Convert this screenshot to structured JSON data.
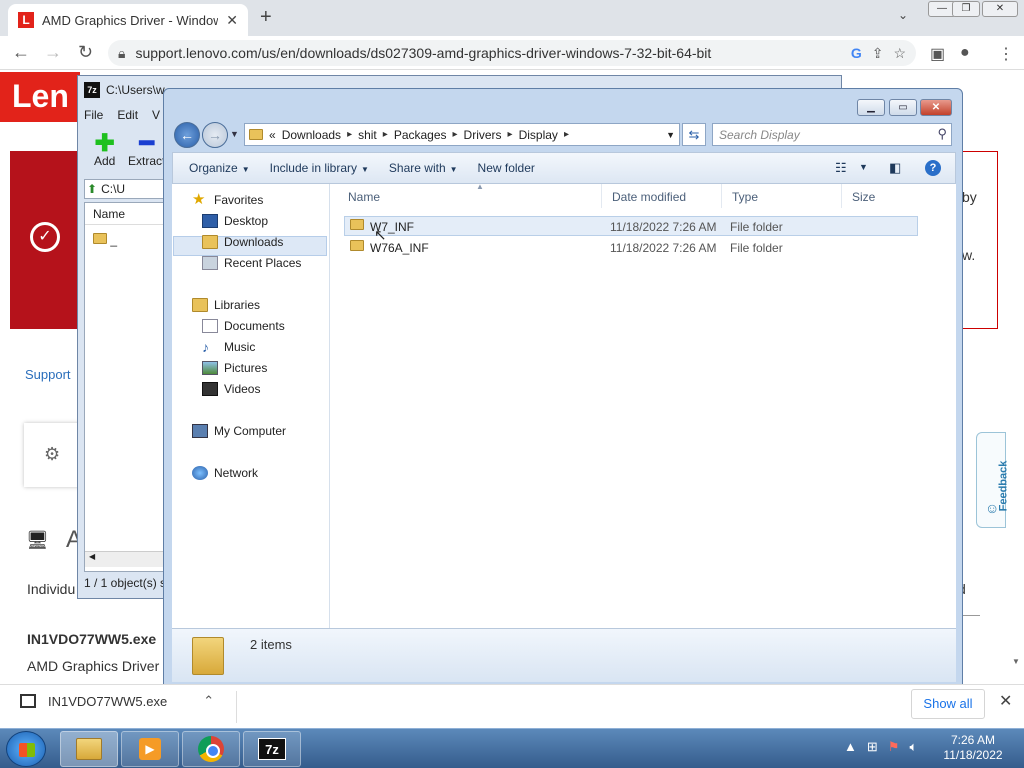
{
  "browser": {
    "tab_title": "AMD Graphics Driver - Windows",
    "tab_favicon_letter": "L",
    "url": "support.lenovo.com/us/en/downloads/ds027309-amd-graphics-driver-windows-7-32-bit-64-bit"
  },
  "page": {
    "logo_text": "Len",
    "support_link": "Support",
    "frag_right_1": "by",
    "frag_right_2": "w.",
    "frag_mid_letter": "A",
    "frag_individual": "Individu",
    "frag_right_3": "d",
    "file_name": "IN1VDO77WW5.exe",
    "file_desc": "AMD Graphics Driver",
    "feedback_label": "Feedback"
  },
  "sevenzip": {
    "title": "C:\\Users\\w",
    "icon_text": "7z",
    "menu": [
      "File",
      "Edit",
      "V"
    ],
    "add_label": "Add",
    "extract_label": "Extract",
    "path": "C:\\U",
    "col_name": "Name",
    "item": "_",
    "status": "1 / 1 object(s) s"
  },
  "explorer": {
    "breadcrumb_overflow": "«",
    "breadcrumbs": [
      "Downloads",
      "shit",
      "Packages",
      "Drivers",
      "Display"
    ],
    "search_placeholder": "Search Display",
    "commands": [
      "Organize",
      "Include in library",
      "Share with",
      "New folder"
    ],
    "nav": {
      "favorites": "Favorites",
      "desktop": "Desktop",
      "downloads": "Downloads",
      "recent_places": "Recent Places",
      "libraries": "Libraries",
      "documents": "Documents",
      "music": "Music",
      "pictures": "Pictures",
      "videos": "Videos",
      "my_computer": "My Computer",
      "network": "Network"
    },
    "columns": {
      "name": "Name",
      "date_modified": "Date modified",
      "type": "Type",
      "size": "Size"
    },
    "files": [
      {
        "name": "W7_INF",
        "date": "11/18/2022 7:26 AM",
        "type": "File folder",
        "size": ""
      },
      {
        "name": "W76A_INF",
        "date": "11/18/2022 7:26 AM",
        "type": "File folder",
        "size": ""
      }
    ],
    "items_count": "2 items"
  },
  "download_shelf": {
    "file": "IN1VDO77WW5.exe",
    "show_all": "Show all"
  },
  "taskbar": {
    "time": "7:26 AM",
    "date": "11/18/2022",
    "sz_label": "7z"
  }
}
